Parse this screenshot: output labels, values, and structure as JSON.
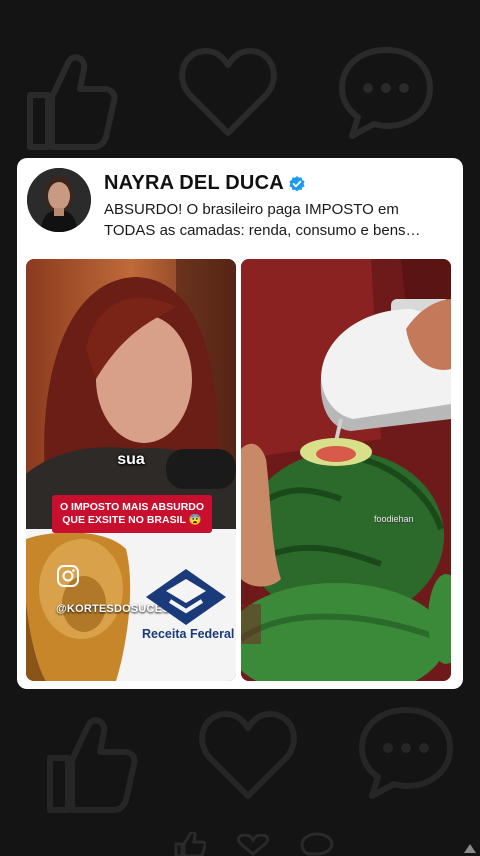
{
  "background": {
    "color": "#141414",
    "icons": [
      "thumbs-up-icon",
      "heart-icon",
      "chat-bubble-icon"
    ]
  },
  "post": {
    "author": "NAYRA DEL DUCA",
    "verified": true,
    "caption_lines": [
      "ABSURDO! O brasileiro paga IMPOSTO em",
      "TODAS as camadas: renda, consumo e bens…"
    ],
    "thumbnail_left": {
      "subtitle": "sua",
      "banner_lines": [
        "O IMPOSTO MAIS ABSURDO",
        "QUE EXSITE NO BRASIL 😨"
      ],
      "handle": "@KORTESDOSUCESSO",
      "agency": "Receita Federal"
    },
    "thumbnail_right": {
      "watermark": "foodiehan"
    }
  },
  "colors": {
    "verified_blue": "#1d9bf0",
    "banner_red": "#c8102e",
    "receita_blue": "#1b3a7a"
  }
}
